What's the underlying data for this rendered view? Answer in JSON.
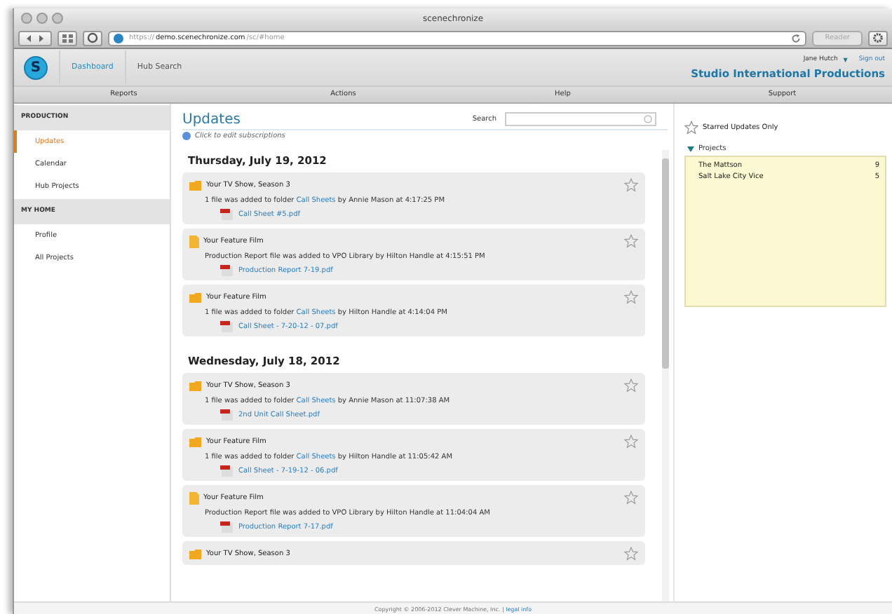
{
  "browser": {
    "title": "scenechronize",
    "url_scheme": "https://",
    "url_host": "demo.scenechronize.com",
    "url_path": "/sc/#home",
    "reader": "Reader"
  },
  "header": {
    "logo": "S",
    "nav": [
      {
        "label": "Dashboard",
        "selected": true
      },
      {
        "label": "Hub Search",
        "selected": false
      }
    ],
    "user": "Jane Hutch",
    "user_caret": "▼",
    "sign_out": "Sign out",
    "company": "Studio International Productions"
  },
  "menu": [
    "Reports",
    "Actions",
    "Help",
    "Support"
  ],
  "sidebar": [
    {
      "heading": "PRODUCTION",
      "items": [
        {
          "label": "Updates",
          "selected": true
        },
        {
          "label": "Calendar",
          "selected": false
        },
        {
          "label": "Hub Projects",
          "selected": false
        }
      ]
    },
    {
      "heading": "MY HOME",
      "items": [
        {
          "label": "Profile",
          "selected": false
        },
        {
          "label": "All Projects",
          "selected": false
        }
      ]
    }
  ],
  "main": {
    "title": "Updates",
    "search_label": "Search",
    "subscriptions": "Click to edit subscriptions",
    "days": [
      {
        "date": "Thursday, July 19, 2012",
        "entries": [
          {
            "kind": "folder",
            "title": "Your TV Show, Season 3",
            "message": [
              {
                "text": "1 file was added to folder ",
                "link": false
              },
              {
                "text": "Call Sheets",
                "link": true
              },
              {
                "text": " by Annie Mason at 4:17:25 PM",
                "link": false
              }
            ],
            "file": "Call Sheet #5.pdf",
            "starred": false
          },
          {
            "kind": "document",
            "title": "Your Feature Film",
            "message": [
              {
                "text": "Production Report file was added to VPO Library by Hilton Handle at 4:15:51 PM",
                "link": false
              }
            ],
            "file": "Production Report 7-19.pdf",
            "starred": false
          },
          {
            "kind": "folder",
            "title": "Your Feature Film",
            "message": [
              {
                "text": "1 file was added to folder ",
                "link": false
              },
              {
                "text": "Call Sheets",
                "link": true
              },
              {
                "text": " by Hilton Handle at 4:14:04 PM",
                "link": false
              }
            ],
            "file": "Call Sheet - 7-20-12 - 07.pdf",
            "starred": false
          }
        ]
      },
      {
        "date": "Wednesday, July 18, 2012",
        "entries": [
          {
            "kind": "folder",
            "title": "Your TV Show, Season 3",
            "message": [
              {
                "text": "1 file was added to folder ",
                "link": false
              },
              {
                "text": "Call Sheets",
                "link": true
              },
              {
                "text": " by Annie Mason at 11:07:38 AM",
                "link": false
              }
            ],
            "file": "2nd Unit Call Sheet.pdf",
            "starred": false
          },
          {
            "kind": "folder",
            "title": "Your Feature Film",
            "message": [
              {
                "text": "1 file was added to folder ",
                "link": false
              },
              {
                "text": "Call Sheets",
                "link": true
              },
              {
                "text": " by Hilton Handle at 11:05:42 AM",
                "link": false
              }
            ],
            "file": "Call Sheet - 7-19-12 - 06.pdf",
            "starred": false
          },
          {
            "kind": "document",
            "title": "Your Feature Film",
            "message": [
              {
                "text": "Production Report file was added to VPO Library by Hilton Handle at 11:04:04 AM",
                "link": false
              }
            ],
            "file": "Production Report 7-17.pdf",
            "starred": false
          },
          {
            "kind": "folder",
            "title": "Your TV Show, Season 3",
            "starred": false
          }
        ]
      }
    ]
  },
  "right": {
    "starred_only": {
      "label": "Starred Updates Only",
      "checked": false
    },
    "projects_heading": "Projects",
    "projects_expanded": true,
    "projects": [
      {
        "name": "The Mattson",
        "count": "9"
      },
      {
        "name": "Salt Lake City Vice",
        "count": "5"
      }
    ]
  },
  "footer": {
    "copyright": "Copyright © 2006-2012 Clever Machine, Inc. | ",
    "legal": "legal info"
  }
}
